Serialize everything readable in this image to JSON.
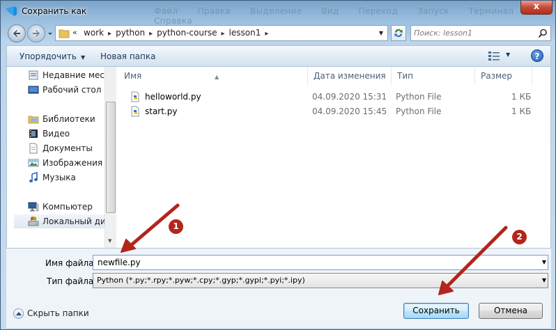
{
  "titlebar": {
    "title": "Сохранить как",
    "ghost_menu": "Файл Правка Выделение Вид Переход Запуск Терминал Справка",
    "close_label": "x"
  },
  "address": {
    "overflow_marker": "«",
    "crumbs": [
      "work",
      "python",
      "python-course",
      "lesson1"
    ]
  },
  "search": {
    "placeholder": "Поиск: lesson1"
  },
  "toolbar": {
    "organize_label": "Упорядочить",
    "new_folder_label": "Новая папка",
    "help_label": "?"
  },
  "nav_pane": {
    "items": [
      {
        "label": "Недавние места",
        "icon": "recent-places-icon"
      },
      {
        "label": "Рабочий стол",
        "icon": "desktop-icon"
      },
      {
        "label": "Библиотеки",
        "icon": "libraries-icon"
      },
      {
        "label": "Видео",
        "icon": "video-icon"
      },
      {
        "label": "Документы",
        "icon": "documents-icon"
      },
      {
        "label": "Изображения",
        "icon": "pictures-icon"
      },
      {
        "label": "Музыка",
        "icon": "music-icon"
      },
      {
        "label": "Компьютер",
        "icon": "computer-icon"
      },
      {
        "label": "Локальный диск",
        "icon": "local-disk-icon"
      }
    ]
  },
  "file_list": {
    "columns": [
      "Имя",
      "Дата изменения",
      "Тип",
      "Размер"
    ],
    "rows": [
      {
        "name": "helloworld.py",
        "date": "04.09.2020 15:31",
        "type": "Python File",
        "size": "1 КБ",
        "icon": "python-file-icon"
      },
      {
        "name": "start.py",
        "date": "04.09.2020 15:45",
        "type": "Python File",
        "size": "1 КБ",
        "icon": "python-file-icon"
      }
    ]
  },
  "bottom": {
    "filename_label": "Имя файла:",
    "filename_value": "newfile.py",
    "filetype_label": "Тип файла:",
    "filetype_value": "Python (*.py;*.rpy;*.pyw;*.cpy;*.gyp;*.gypi;*.pyi;*.ipy)",
    "hide_folders_label": "Скрыть папки",
    "save_label": "Сохранить",
    "cancel_label": "Отмена"
  },
  "annotations": {
    "badge_1": "1",
    "badge_2": "2",
    "color": "#b2261c"
  },
  "colors": {
    "accent": "#1a3a5c",
    "annotation_red": "#b2261c",
    "primary_button": "#bee6fd"
  }
}
